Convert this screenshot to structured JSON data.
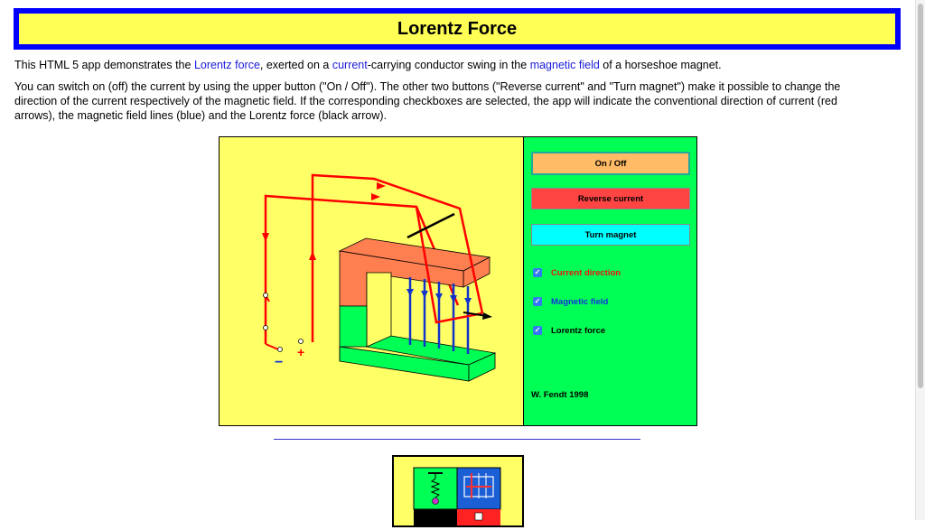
{
  "page": {
    "title": "Lorentz Force",
    "intro": {
      "t1": "This HTML 5 app demonstrates the ",
      "link_force": "Lorentz force",
      "t2": ", exerted on a ",
      "link_current": "current",
      "t3": "-carrying conductor swing in the ",
      "link_field": "magnetic field",
      "t4": " of a horseshoe magnet."
    },
    "description": "You can switch on (off) the current by using the upper button (\"On / Off\"). The other two buttons (\"Reverse current\" and \"Turn magnet\") make it possible to change the direction of the current respectively of the magnetic field. If the corresponding checkboxes are selected, the app will indicate the conventional direction of current (red arrows), the magnetic field lines (blue) and the Lorentz force (black arrow)."
  },
  "app": {
    "buttons": {
      "on_off": "On / Off",
      "reverse_current": "Reverse current",
      "turn_magnet": "Turn magnet"
    },
    "checkboxes": {
      "current_direction": {
        "label": "Current direction",
        "checked": true
      },
      "magnetic_field": {
        "label": "Magnetic field",
        "checked": true
      },
      "lorentz_force": {
        "label": "Lorentz force",
        "checked": true
      }
    },
    "terminals": {
      "minus": "−",
      "plus": "+"
    },
    "author": "W. Fendt 1998",
    "colors": {
      "canvas_bg": "#ffff66",
      "panel_bg": "#00ff55",
      "current": "#ff0000",
      "field": "#0000ff",
      "magnet_north": "#ff7f50",
      "magnet_south": "#00ff55"
    }
  }
}
